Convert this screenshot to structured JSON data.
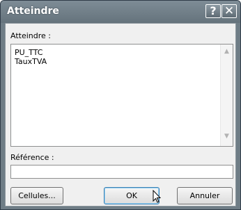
{
  "window": {
    "title": "Atteindre"
  },
  "titlebar": {
    "help_label": "?",
    "close_label": "✕"
  },
  "goto": {
    "label": "Atteindre :",
    "items": [
      "PU_TTC",
      "TauxTVA"
    ],
    "scroll_up": "▲",
    "scroll_down": "▼"
  },
  "reference": {
    "label": "Référence :",
    "value": ""
  },
  "buttons": {
    "cellules": "Cellules...",
    "ok": "OK",
    "annuler": "Annuler"
  }
}
